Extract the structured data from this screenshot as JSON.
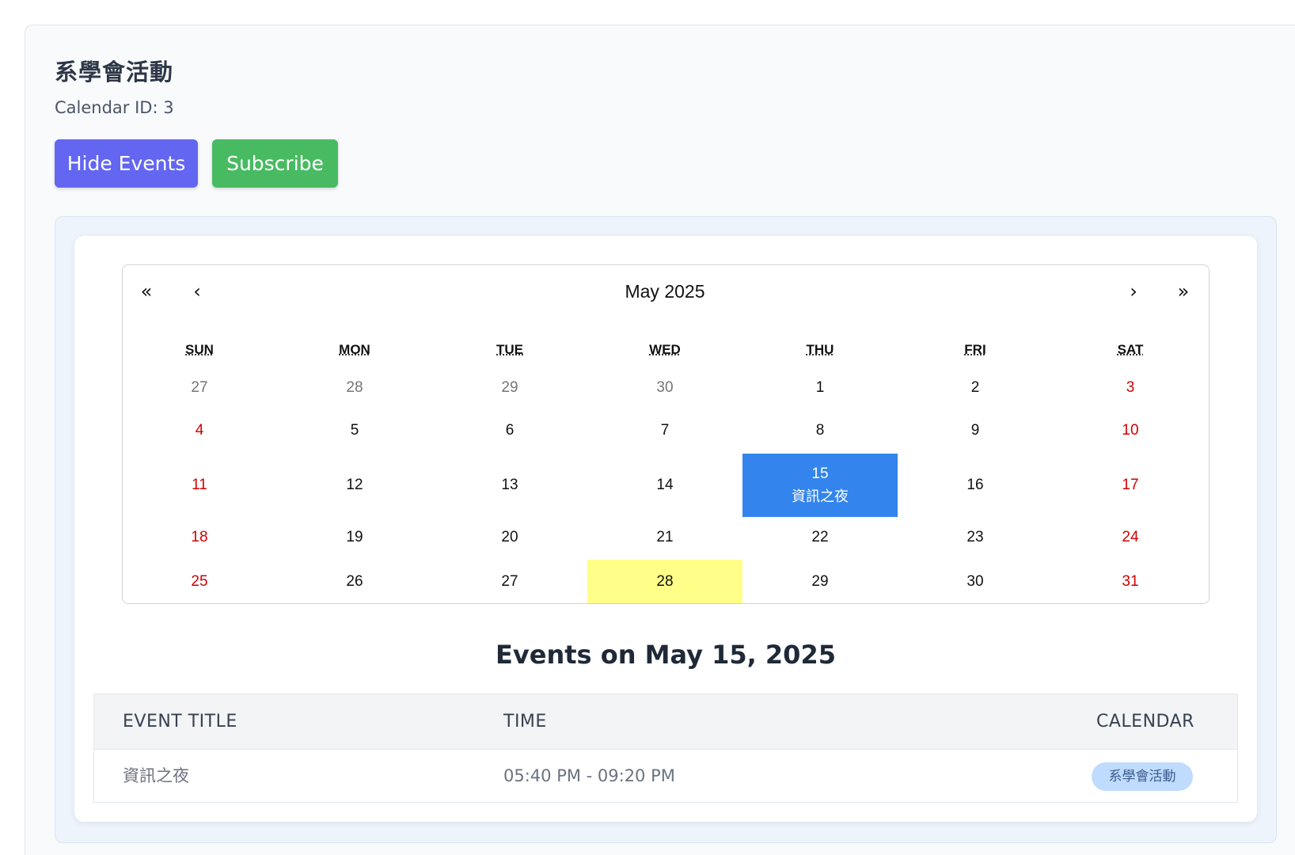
{
  "calendar": {
    "title": "系學會活動",
    "id_text": "Calendar ID: 3"
  },
  "actions": {
    "hide_label": "Hide Events",
    "subscribe_label": "Subscribe"
  },
  "colors": {
    "hide_button": "#6366f1",
    "subscribe_button": "#48bb62",
    "selected_day": "#3384ec",
    "today_highlight": "#fefe88",
    "weekend_text": "#d10000",
    "badge": "#bfdbfe"
  },
  "nav": {
    "prev_year": "«",
    "prev_month": "‹",
    "month_label": "May 2025",
    "next_month": "›",
    "next_year": "»"
  },
  "weekdays": [
    "SUN",
    "MON",
    "TUE",
    "WED",
    "THU",
    "FRI",
    "SAT"
  ],
  "weeks": [
    [
      {
        "day": "27",
        "kind": "outside"
      },
      {
        "day": "28",
        "kind": "outside"
      },
      {
        "day": "29",
        "kind": "outside"
      },
      {
        "day": "30",
        "kind": "outside"
      },
      {
        "day": "1",
        "kind": "normal"
      },
      {
        "day": "2",
        "kind": "normal"
      },
      {
        "day": "3",
        "kind": "weekend"
      }
    ],
    [
      {
        "day": "4",
        "kind": "weekend"
      },
      {
        "day": "5",
        "kind": "normal"
      },
      {
        "day": "6",
        "kind": "normal"
      },
      {
        "day": "7",
        "kind": "normal"
      },
      {
        "day": "8",
        "kind": "normal"
      },
      {
        "day": "9",
        "kind": "normal"
      },
      {
        "day": "10",
        "kind": "weekend"
      }
    ],
    [
      {
        "day": "11",
        "kind": "weekend"
      },
      {
        "day": "12",
        "kind": "normal"
      },
      {
        "day": "13",
        "kind": "normal"
      },
      {
        "day": "14",
        "kind": "normal"
      },
      {
        "day": "15",
        "kind": "selected",
        "event": "資訊之夜"
      },
      {
        "day": "16",
        "kind": "normal"
      },
      {
        "day": "17",
        "kind": "weekend"
      }
    ],
    [
      {
        "day": "18",
        "kind": "weekend"
      },
      {
        "day": "19",
        "kind": "normal"
      },
      {
        "day": "20",
        "kind": "normal"
      },
      {
        "day": "21",
        "kind": "normal"
      },
      {
        "day": "22",
        "kind": "normal"
      },
      {
        "day": "23",
        "kind": "normal"
      },
      {
        "day": "24",
        "kind": "weekend"
      }
    ],
    [
      {
        "day": "25",
        "kind": "weekend"
      },
      {
        "day": "26",
        "kind": "normal"
      },
      {
        "day": "27",
        "kind": "normal"
      },
      {
        "day": "28",
        "kind": "today"
      },
      {
        "day": "29",
        "kind": "normal"
      },
      {
        "day": "30",
        "kind": "normal"
      },
      {
        "day": "31",
        "kind": "weekend"
      }
    ]
  ],
  "events_section": {
    "heading": "Events on May 15, 2025",
    "columns": {
      "title": "EVENT TITLE",
      "time": "TIME",
      "calendar": "CALENDAR"
    },
    "rows": [
      {
        "title": "資訊之夜",
        "time": "05:40 PM - 09:20 PM",
        "calendar": "系學會活動"
      }
    ]
  }
}
